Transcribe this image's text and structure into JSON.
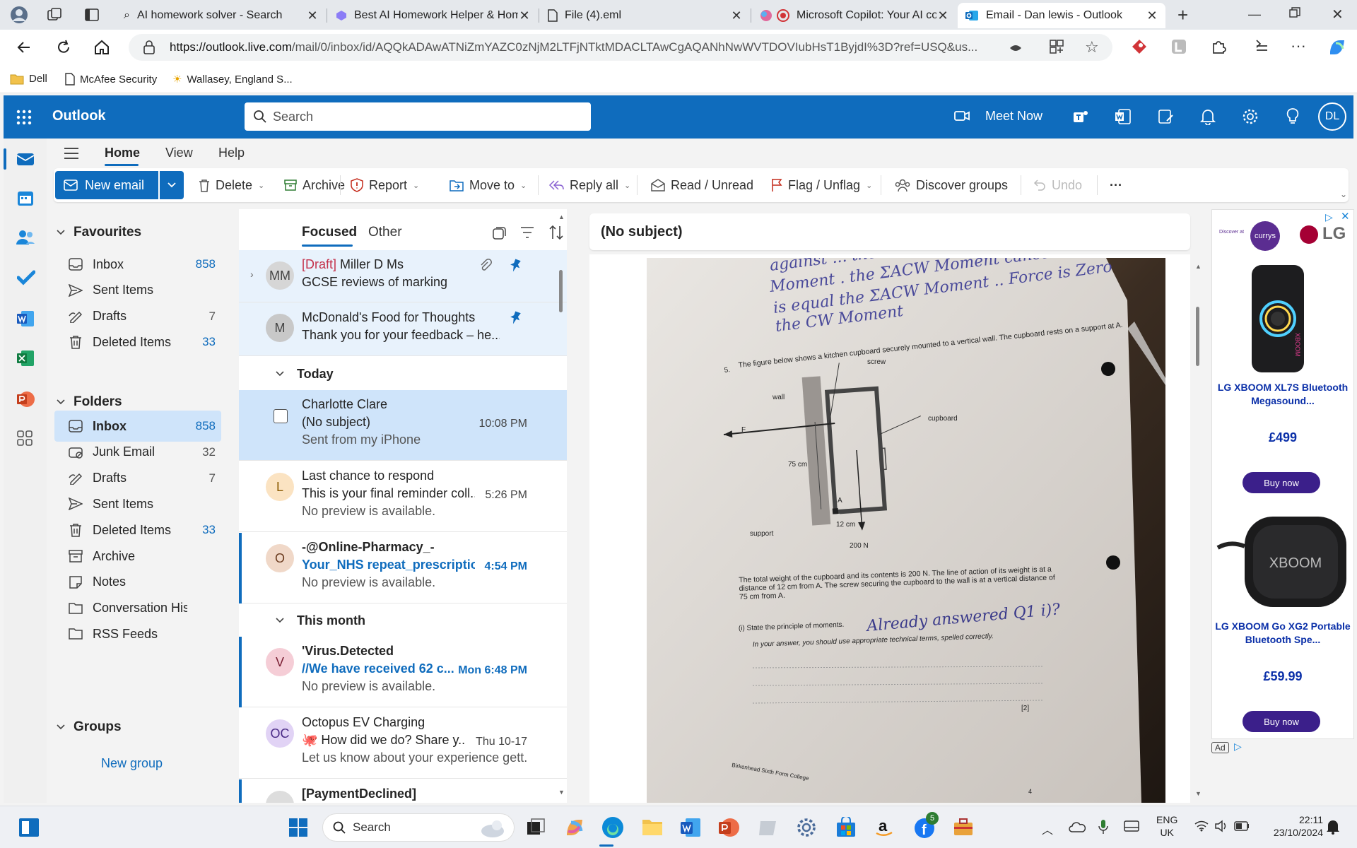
{
  "browser": {
    "tabs": [
      {
        "title": "AI homework solver - Search"
      },
      {
        "title": "Best AI Homework Helper & Hom"
      },
      {
        "title": "File (4).eml"
      },
      {
        "title": "Microsoft Copilot: Your AI co"
      },
      {
        "title": "Email - Dan lewis - Outlook"
      }
    ],
    "url_host": "https://outlook.live.com",
    "url_path": "/mail/0/inbox/id/AQQkADAwATNiZmYAZC0zNjM2LTFjNTktMDACLTAwCgAQANhNwWVTDOVIubHsT1ByjdI%3D?ref=USQ&us...",
    "favorites": [
      "Dell",
      "McAfee Security",
      "Wallasey, England S..."
    ]
  },
  "outlook": {
    "app_name": "Outlook",
    "search_placeholder": "Search",
    "meet_now": "Meet Now",
    "avatar_initials": "DL"
  },
  "ribbon": {
    "tabs": [
      "Home",
      "View",
      "Help"
    ],
    "new_email": "New email",
    "delete": "Delete",
    "archive": "Archive",
    "report": "Report",
    "move_to": "Move to",
    "reply_all": "Reply all",
    "read_unread": "Read / Unread",
    "flag": "Flag / Unflag",
    "discover": "Discover groups",
    "undo": "Undo",
    "more": "···"
  },
  "folders": {
    "favourites_label": "Favourites",
    "favourites": [
      {
        "label": "Inbox",
        "count": "858",
        "icon": "inbox-icon"
      },
      {
        "label": "Sent Items",
        "count": "",
        "icon": "send-icon"
      },
      {
        "label": "Drafts",
        "count": "7",
        "icon": "draft-icon"
      },
      {
        "label": "Deleted Items",
        "count": "33",
        "icon": "trash-icon"
      }
    ],
    "folders_label": "Folders",
    "folders": [
      {
        "label": "Inbox",
        "count": "858",
        "icon": "inbox-icon"
      },
      {
        "label": "Junk Email",
        "count": "32",
        "icon": "junk-icon"
      },
      {
        "label": "Drafts",
        "count": "7",
        "icon": "draft-icon"
      },
      {
        "label": "Sent Items",
        "count": "",
        "icon": "send-icon"
      },
      {
        "label": "Deleted Items",
        "count": "33",
        "icon": "trash-icon"
      },
      {
        "label": "Archive",
        "count": "",
        "icon": "archive-icon"
      },
      {
        "label": "Notes",
        "count": "",
        "icon": "note-icon"
      },
      {
        "label": "Conversation Histo...",
        "count": "",
        "icon": "folder-icon"
      },
      {
        "label": "RSS Feeds",
        "count": "",
        "icon": "folder-icon"
      }
    ],
    "groups_label": "Groups",
    "new_group": "New group"
  },
  "message_list": {
    "tab_focused": "Focused",
    "tab_other": "Other",
    "group_today": "Today",
    "group_month": "This month",
    "pinned": [
      {
        "initials": "MM",
        "draft_tag": "[Draft]",
        "from": " Miller D Ms",
        "subject": "GCSE reviews of marking"
      },
      {
        "initials": "M",
        "from": "McDonald's Food for Thoughts",
        "subject": "Thank you for your feedback – he..."
      }
    ],
    "today": [
      {
        "initials": "",
        "from": "Charlotte Clare",
        "subject": "(No subject)",
        "preview": "Sent from my iPhone",
        "time": "10:08 PM"
      },
      {
        "initials": "L",
        "from": "Last chance to respond",
        "subject": "This is your final reminder coll...",
        "preview": "No preview is available.",
        "time": "5:26 PM"
      },
      {
        "initials": "O",
        "from": "-@Online-Pharmacy_-",
        "subject": "Your_NHS repeat_prescriptio...",
        "preview": "No preview is available.",
        "time": "4:54 PM"
      }
    ],
    "month": [
      {
        "initials": "V",
        "from": "'Virus.Detected",
        "subject": "//We have received 62 c...",
        "preview": "No preview is available.",
        "time": "Mon 6:48 PM"
      },
      {
        "initials": "OC",
        "from": "Octopus EV Charging",
        "subject": "🐙 How did we do? Share y...",
        "preview": "Let us know about your experience gett...",
        "time": "Thu 10-17"
      },
      {
        "initials": "",
        "from": "[PaymentDeclined]",
        "subject": "",
        "preview": "",
        "time": ""
      }
    ]
  },
  "reading_pane": {
    "subject": "(No subject)",
    "paper": {
      "handwriting_top_1": "against ... the ΣACW ...",
      "handwriting_top_2": "Moment . the ΣACW Moment cancels out",
      "handwriting_top_3": "is equal the ΣACW Moment .. Force is Zero",
      "handwriting_top_4": "the CW Moment",
      "q_number": "5.",
      "q_intro": "The figure below shows a kitchen cupboard securely mounted to a vertical wall. The cupboard rests on a support at A.",
      "label_screw": "screw",
      "label_wall": "wall",
      "label_cupboard": "cupboard",
      "label_f": "F",
      "label_75": "75 cm",
      "label_a": "A",
      "label_support": "support",
      "label_12": "12 cm",
      "label_200": "200 N",
      "body_text": "The total weight of the cupboard and its contents is 200 N. The line of action of its weight is at a distance of 12 cm from A. The screw securing the cupboard to the wall is at a vertical distance of 75 cm from A.",
      "part_i": "(i)   State the principle of moments.",
      "handwritten_answer": "Already answered Q1 i)?",
      "instruction": "In your answer, you should use appropriate technical terms, spelled correctly.",
      "marks": "[2]",
      "footer": "Birkenhead Sixth Form College",
      "page_no": "4"
    }
  },
  "ad": {
    "brand_left": "Discover at",
    "brand_currys": "currys",
    "brand_lg": "LG",
    "product1": "LG XBOOM XL7S Bluetooth Megasound...",
    "price1": "£499",
    "buy": "Buy now",
    "product2": "LG XBOOM Go XG2 Portable Bluetooth Spe...",
    "price2": "£59.99",
    "ad_label": "Ad",
    "speaker1_label": "XBOOM",
    "speaker2_label": "XBOOM"
  },
  "taskbar": {
    "search": "Search",
    "lang1": "ENG",
    "lang2": "UK",
    "time": "22:11",
    "date": "23/10/2024",
    "fb_badge": "5"
  },
  "colors": {
    "outlook_blue": "#0f6cbd",
    "selected_row": "#cfe4fa",
    "accent_link": "#0f6cbd"
  }
}
